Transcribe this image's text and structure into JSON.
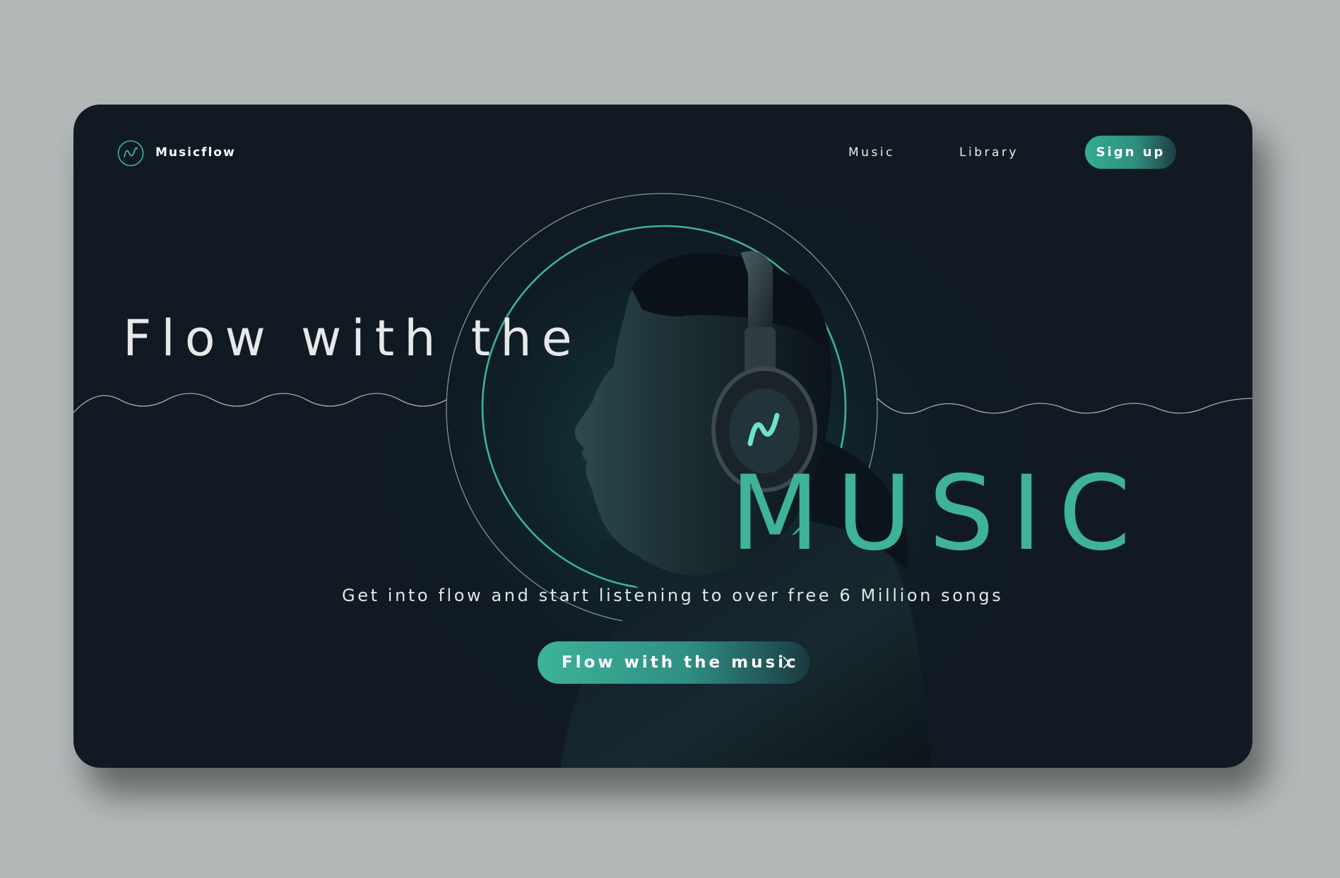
{
  "brand": {
    "name": "Musicflow",
    "logo_icon": "wave-logo-icon",
    "accent_color": "#3fb29a"
  },
  "nav": {
    "links": [
      {
        "label": "Music"
      },
      {
        "label": "Library"
      }
    ],
    "signup_label": "Sign up"
  },
  "hero": {
    "headline": "Flow with the",
    "highlight": "MUSIC",
    "subtitle": "Get into flow and start listening to over free 6 Million songs",
    "cta_label": "Flow with the music",
    "cta_icon": "chevron-right-icon",
    "image": "man-with-headphones-silhouette"
  }
}
